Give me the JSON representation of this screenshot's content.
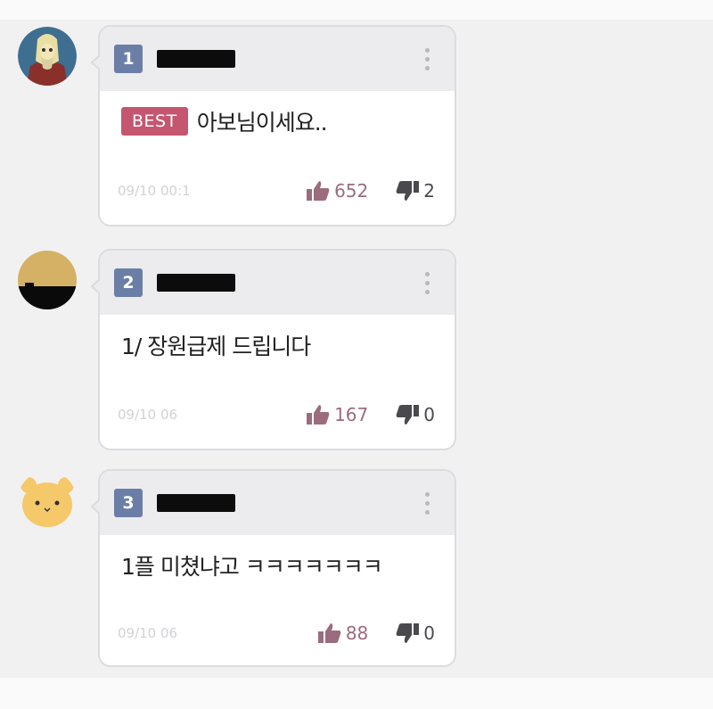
{
  "comments": [
    {
      "rank": "1",
      "nickname": "—————",
      "best_label": "BEST",
      "text": "아보님이세요..",
      "time": "09/10 00:1",
      "likes": "652",
      "dislikes": "2",
      "avatar": "cartoon-character"
    },
    {
      "rank": "2",
      "nickname": "—————",
      "text": "1/ 장원급제 드립니다",
      "time": "09/10 06",
      "likes": "167",
      "dislikes": "0",
      "avatar": "sunset-silhouette"
    },
    {
      "rank": "3",
      "nickname": "—————",
      "text": "1플 미쳤냐고 ㅋㅋㅋㅋㅋㅋㅋ",
      "time": "09/10 06",
      "likes": "88",
      "dislikes": "0",
      "avatar": "yellow-bear"
    }
  ],
  "colors": {
    "badge": "#6b7fa6",
    "best": "#c55670",
    "like": "#9b6c7e",
    "dislike": "#4a4a4e"
  }
}
